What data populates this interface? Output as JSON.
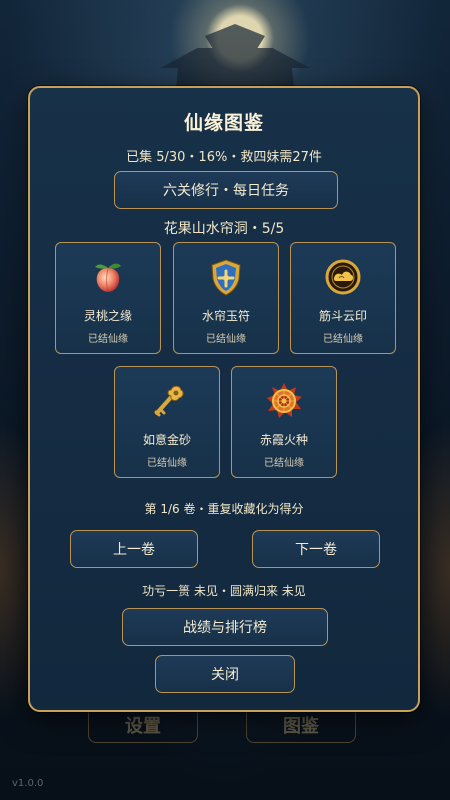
{
  "background": {
    "tabs": {
      "settings_label": "设置",
      "codex_label": "图鉴"
    },
    "version": "v1.0.0"
  },
  "modal": {
    "title": "仙缘图鉴",
    "progress": "已集 5/30・16%・救四妹需27件",
    "daily_button": "六关修行・每日任务",
    "chapter_title": "花果山水帘洞・5/5",
    "cards": [
      {
        "name": "灵桃之缘",
        "status": "已结仙缘",
        "icon": "peach-icon"
      },
      {
        "name": "水帘玉符",
        "status": "已结仙缘",
        "icon": "shield-icon"
      },
      {
        "name": "筋斗云印",
        "status": "已结仙缘",
        "icon": "cloud-seal-icon"
      },
      {
        "name": "如意金砂",
        "status": "已结仙缘",
        "icon": "golden-key-icon"
      },
      {
        "name": "赤霞火种",
        "status": "已结仙缘",
        "icon": "fire-emblem-icon"
      }
    ],
    "volume_text": "第 1/6 卷・重复收藏化为得分",
    "prev_button": "上一卷",
    "next_button": "下一卷",
    "achievements_text": "功亏一篑 未见・圆满归来 未见",
    "rank_button": "战绩与排行榜",
    "close_button": "关闭"
  },
  "colors": {
    "panel": "#173149",
    "border_gold": "#c9a05a",
    "text": "#f6ecd2"
  }
}
